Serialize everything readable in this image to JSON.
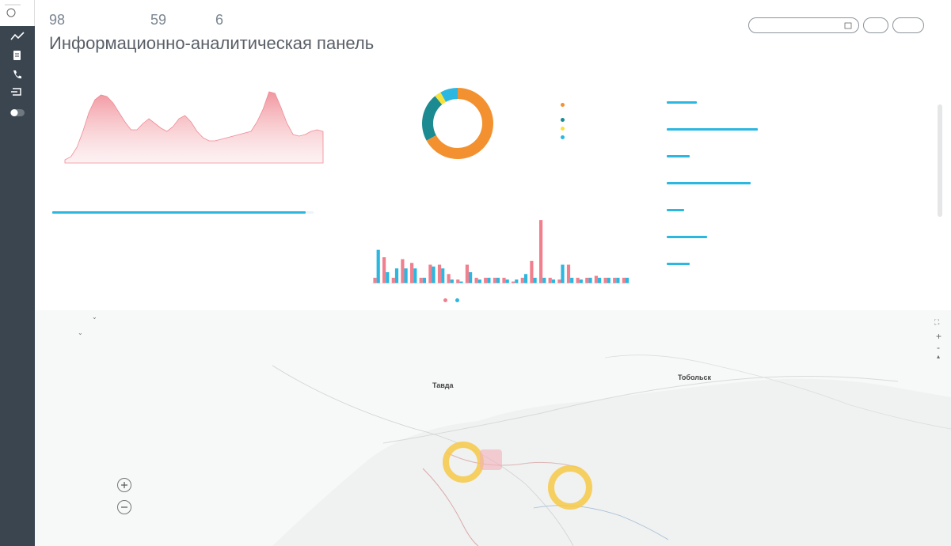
{
  "header": {
    "stats": [
      {
        "value": "98",
        "label": ""
      },
      {
        "value": "59",
        "label": ""
      },
      {
        "value": "6",
        "label": ""
      }
    ],
    "title": "Информационно-аналитическая панель",
    "date_from": "",
    "date_to": "",
    "buttons": [
      "",
      ""
    ],
    "link": ""
  },
  "incidents": {
    "title": "",
    "y_ticks": [
      "",
      "",
      "",
      "",
      ""
    ],
    "x_ticks": [
      "",
      "",
      "",
      "",
      "",
      "",
      "",
      "",
      ""
    ]
  },
  "sources": {
    "title": "",
    "value": "",
    "fill": 0.97
  },
  "statuses": {
    "title": "",
    "center": "",
    "legend": [
      {
        "label": "",
        "value": "",
        "color": "#f39130"
      },
      {
        "label": "",
        "value": "",
        "color": "#1b8a91"
      },
      {
        "label": "",
        "value": "",
        "color": "#f7e23a"
      },
      {
        "label": "",
        "value": "",
        "color": "#2bb7e0"
      }
    ]
  },
  "appeals": {
    "title": "",
    "y_ticks": [
      "",
      "",
      "",
      "",
      ""
    ],
    "x_ticks": [
      "",
      "",
      "",
      "",
      "",
      "",
      "",
      "",
      "",
      ""
    ],
    "legend": [
      "",
      ""
    ]
  },
  "services": {
    "title": "",
    "items": [
      {
        "name": "",
        "value": "",
        "fill": 0.12
      },
      {
        "name": "",
        "value": "",
        "fill": 0.36
      },
      {
        "name": "",
        "value": "",
        "fill": 0.09
      },
      {
        "name": "",
        "value": "",
        "fill": 0.33
      },
      {
        "name": "",
        "value": "",
        "fill": 0.07
      },
      {
        "name": "",
        "value": "",
        "fill": 0.16
      },
      {
        "name": "",
        "value": "",
        "fill": 0.09
      },
      {
        "name": "",
        "value": "",
        "fill": 0
      }
    ]
  },
  "map": {
    "filter1": "",
    "filter2": "",
    "filter_label": "",
    "labels": [
      "Тавда",
      "Тобольск"
    ],
    "clusters": [
      {
        "label": ""
      },
      {
        "label": ""
      }
    ],
    "footer": "",
    "copyright": ""
  },
  "chart_data": [
    {
      "type": "area",
      "title": "",
      "x": [
        1,
        2,
        3,
        4,
        5,
        6,
        7,
        8,
        9,
        10,
        11,
        12,
        13,
        14,
        15,
        16,
        17,
        18,
        19,
        20,
        21,
        22,
        23,
        24,
        25,
        26,
        27,
        28,
        29,
        30,
        31,
        32,
        33,
        34,
        35,
        36,
        37,
        38,
        39,
        40,
        41,
        42,
        43,
        44
      ],
      "values": [
        0.2,
        0.4,
        1.0,
        2.0,
        3.2,
        4.0,
        4.3,
        4.2,
        3.8,
        3.2,
        2.6,
        2.1,
        2.1,
        2.5,
        2.8,
        2.5,
        2.2,
        2.0,
        2.3,
        2.8,
        3.0,
        2.6,
        2.0,
        1.6,
        1.4,
        1.4,
        1.5,
        1.6,
        1.7,
        1.8,
        1.9,
        2.0,
        2.6,
        3.4,
        4.5,
        4.4,
        3.5,
        2.5,
        1.8,
        1.7,
        1.8,
        2.0,
        2.1,
        2.0
      ],
      "color": "#f08a94",
      "ylim": [
        0,
        5
      ]
    },
    {
      "type": "pie",
      "title": "",
      "values": [
        67,
        22,
        3,
        8
      ],
      "colors": [
        "#f39130",
        "#1b8a91",
        "#f7e23a",
        "#2bb7e0"
      ]
    },
    {
      "type": "bar",
      "title": "",
      "categories": [
        "1",
        "2",
        "3",
        "4",
        "5",
        "6",
        "7",
        "8",
        "9",
        "10",
        "11",
        "12",
        "13",
        "14",
        "15",
        "16",
        "17",
        "18",
        "19",
        "20",
        "21",
        "22",
        "23",
        "24",
        "25",
        "26",
        "27",
        "28"
      ],
      "series": [
        {
          "name": "",
          "color": "#f0808e",
          "values": [
            3,
            14,
            3,
            13,
            11,
            3,
            10,
            10,
            5,
            2,
            10,
            3,
            3,
            3,
            3,
            1,
            3,
            12,
            34,
            3,
            2,
            10,
            3,
            3,
            4,
            3,
            3,
            3
          ]
        },
        {
          "name": "",
          "color": "#2bb7e0",
          "values": [
            18,
            6,
            8,
            8,
            8,
            3,
            9,
            8,
            2,
            1,
            6,
            2,
            3,
            3,
            2,
            2,
            5,
            3,
            3,
            2,
            10,
            3,
            2,
            3,
            3,
            3,
            3,
            3
          ]
        }
      ],
      "ylim": [
        0,
        40
      ]
    }
  ]
}
